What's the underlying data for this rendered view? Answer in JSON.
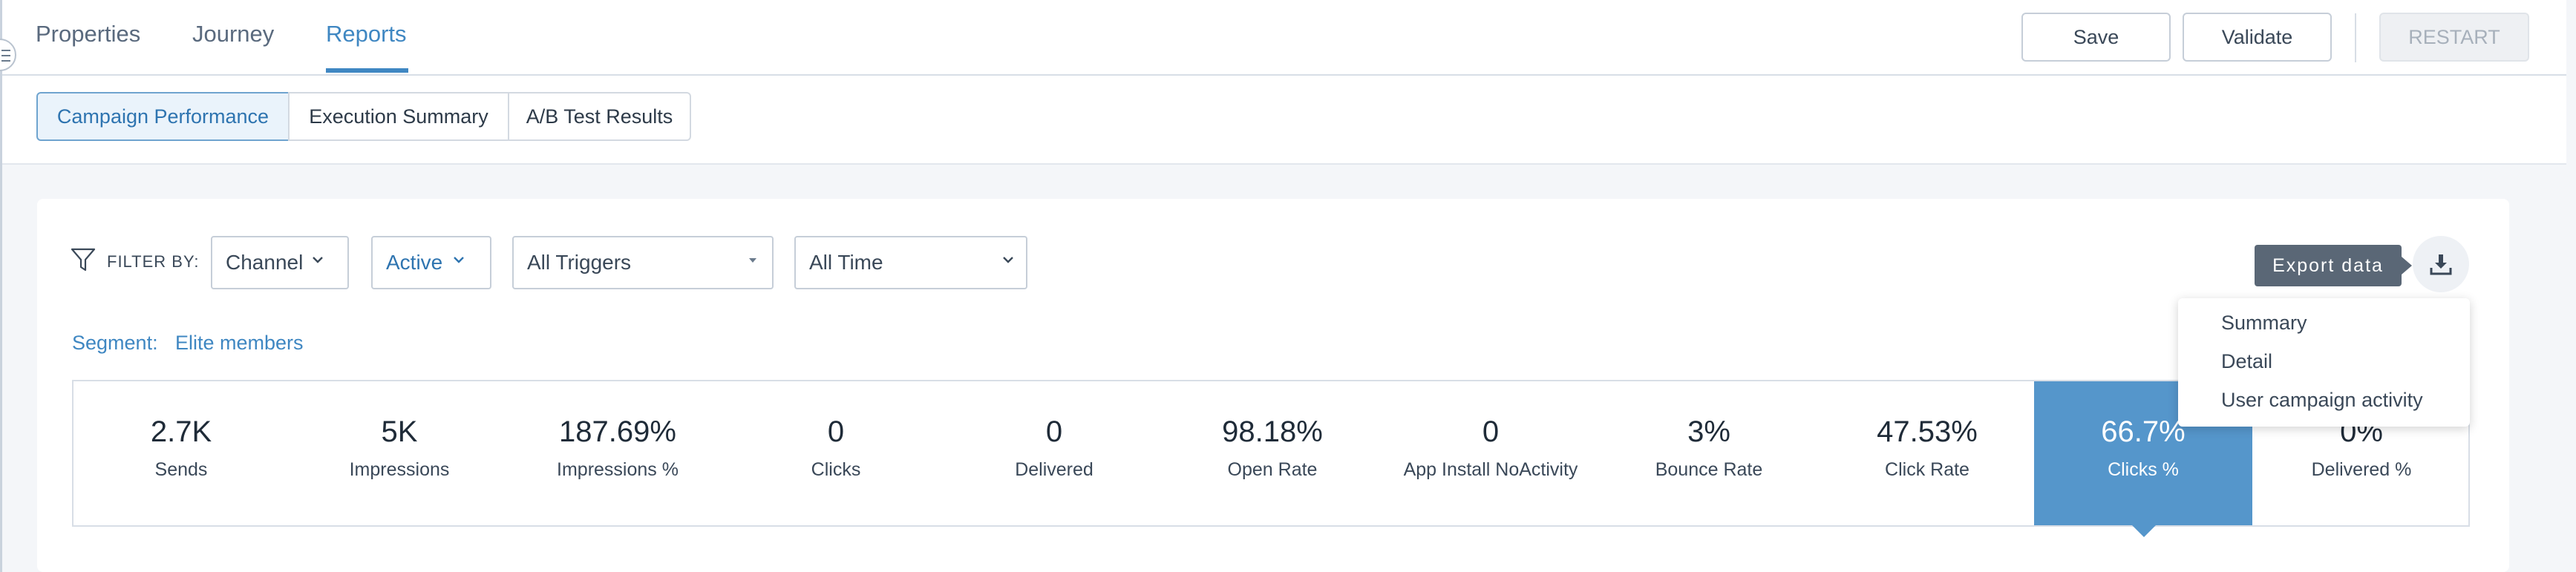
{
  "header": {
    "tabs": [
      {
        "label": "Properties",
        "active": false
      },
      {
        "label": "Journey",
        "active": false
      },
      {
        "label": "Reports",
        "active": true
      }
    ],
    "save_label": "Save",
    "validate_label": "Validate",
    "restart_label": "RESTART"
  },
  "subtabs": [
    {
      "label": "Campaign Performance",
      "active": true
    },
    {
      "label": "Execution Summary",
      "active": false
    },
    {
      "label": "A/B Test Results",
      "active": false
    }
  ],
  "filters": {
    "label": "FILTER BY:",
    "channel": "Channel",
    "status": "Active",
    "trigger": "All Triggers",
    "time": "All Time"
  },
  "segment": {
    "label": "Segment:",
    "value": "Elite members"
  },
  "export": {
    "tooltip": "Export data",
    "menu": [
      "Summary",
      "Detail",
      "User campaign activity"
    ]
  },
  "metrics": [
    {
      "value": "2.7K",
      "label": "Sends"
    },
    {
      "value": "5K",
      "label": "Impressions"
    },
    {
      "value": "187.69%",
      "label": "Impressions %"
    },
    {
      "value": "0",
      "label": "Clicks"
    },
    {
      "value": "0",
      "label": "Delivered"
    },
    {
      "value": "98.18%",
      "label": "Open Rate"
    },
    {
      "value": "0",
      "label": "App Install NoActivity"
    },
    {
      "value": "3%",
      "label": "Bounce Rate"
    },
    {
      "value": "47.53%",
      "label": "Click Rate"
    },
    {
      "value": "66.7%",
      "label": "Clicks %",
      "selected": true
    },
    {
      "value": "0%",
      "label": "Delivered %"
    }
  ],
  "colors": {
    "accent": "#3f87c2",
    "selected_metric": "#5596cb",
    "tooltip": "#5a6776"
  }
}
